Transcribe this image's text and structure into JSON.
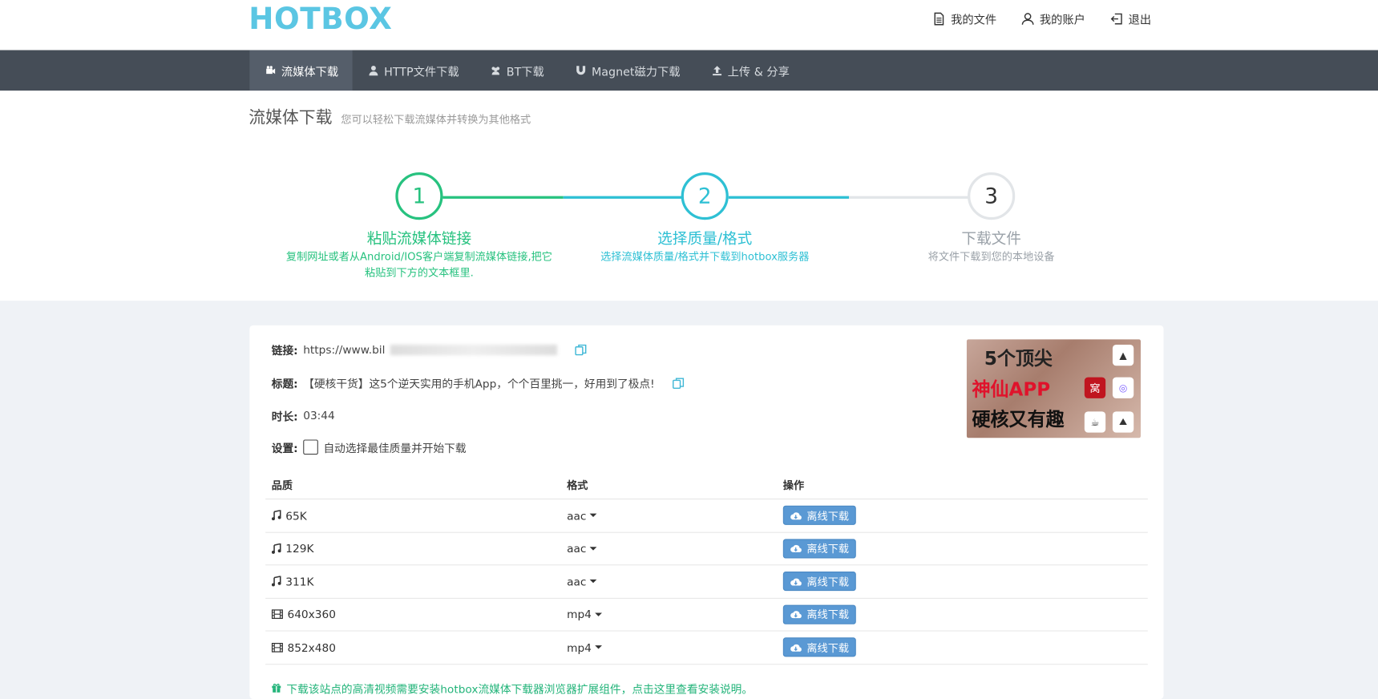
{
  "header": {
    "logo": "HOTBOX",
    "links": [
      {
        "label": "我的文件",
        "icon": "file-icon"
      },
      {
        "label": "我的账户",
        "icon": "user-icon"
      },
      {
        "label": "退出",
        "icon": "logout-icon"
      }
    ]
  },
  "nav": {
    "items": [
      {
        "label": "流媒体下载",
        "icon": "video-icon",
        "active": true
      },
      {
        "label": "HTTP文件下载",
        "icon": "user-icon"
      },
      {
        "label": "BT下载",
        "icon": "users-icon"
      },
      {
        "label": "Magnet磁力下载",
        "icon": "magnet-icon"
      },
      {
        "label": "上传 & 分享",
        "icon": "upload-icon"
      }
    ]
  },
  "page": {
    "title": "流媒体下载",
    "subtitle": "您可以轻松下载流媒体并转换为其他格式"
  },
  "steps": [
    {
      "number": "1",
      "title": "粘贴流媒体链接",
      "desc_line1": "复制网址或者从Android/IOS客户端复制流媒体链接,把它",
      "desc_line2": "粘贴到下方的文本框里.",
      "color": "#27c27f"
    },
    {
      "number": "2",
      "title": "选择质量/格式",
      "desc_line1": "选择流媒体质量/格式并下载到hotbox服务器",
      "desc_line2": "",
      "color": "#2ec0d4"
    },
    {
      "number": "3",
      "title": "下载文件",
      "desc_line1": "将文件下载到您的本地设备",
      "desc_line2": "",
      "color": "#9aa1a8"
    }
  ],
  "info": {
    "link_label": "链接:",
    "link_value": "https://www.bil",
    "title_label": "标题:",
    "title_value": "【硬核干货】这5个逆天实用的手机App，个个百里挑一，好用到了极点!",
    "duration_label": "时长:",
    "duration_value": "03:44",
    "settings_label": "设置:",
    "settings_option": "自动选择最佳质量并开始下载"
  },
  "thumbnail": {
    "line1": "5个顶尖",
    "line2": "神仙APP",
    "line3": "硬核又有趣",
    "badge": "窝"
  },
  "table": {
    "headers": [
      "品质",
      "格式",
      "操作"
    ],
    "rows": [
      {
        "quality": "65K",
        "icon": "music-icon",
        "format": "aac",
        "action": "离线下载"
      },
      {
        "quality": "129K",
        "icon": "music-icon",
        "format": "aac",
        "action": "离线下载"
      },
      {
        "quality": "311K",
        "icon": "music-icon",
        "format": "aac",
        "action": "离线下载"
      },
      {
        "quality": "640x360",
        "icon": "film-icon",
        "format": "mp4",
        "action": "离线下载"
      },
      {
        "quality": "852x480",
        "icon": "film-icon",
        "format": "mp4",
        "action": "离线下载"
      }
    ]
  },
  "footer_note": "下载该站点的高清视频需要安装hotbox流媒体下载器浏览器扩展组件，点击这里查看安装说明。"
}
